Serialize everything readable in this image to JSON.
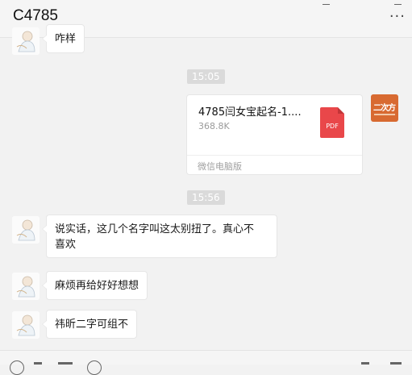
{
  "header": {
    "title": "C4785",
    "more_label": "···"
  },
  "messages": [
    {
      "type": "text",
      "from": "other",
      "text": "咋样"
    },
    {
      "type": "time",
      "text": "15:05"
    },
    {
      "type": "file",
      "from": "self",
      "file_name": "4785闫女宝起名-1....",
      "file_size": "368.8K",
      "file_type": "PDF",
      "source": "微信电脑版"
    },
    {
      "type": "time",
      "text": "15:56"
    },
    {
      "type": "text",
      "from": "other",
      "text_line1": "说实话，这几个名字叫这太别扭了。真心不",
      "text_line2": "喜欢"
    },
    {
      "type": "text",
      "from": "other",
      "text": "麻烦再给好好想想"
    },
    {
      "type": "text",
      "from": "other",
      "text": "祎昕二字可组不"
    }
  ],
  "self_avatar": {
    "logo_text": "二次方"
  },
  "colors": {
    "background": "#f2f2f2",
    "pdf": "#e9474a",
    "self_avatar": "#d86a31"
  }
}
